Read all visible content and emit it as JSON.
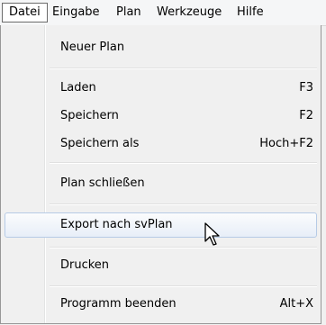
{
  "menubar": {
    "items": [
      {
        "label": "Datei"
      },
      {
        "label": "Eingabe"
      },
      {
        "label": "Plan"
      },
      {
        "label": "Werkzeuge"
      },
      {
        "label": "Hilfe"
      }
    ]
  },
  "file_menu": {
    "items": [
      {
        "label": "Neuer Plan",
        "shortcut": ""
      },
      {
        "label": "Laden",
        "shortcut": "F3"
      },
      {
        "label": "Speichern",
        "shortcut": "F2"
      },
      {
        "label": "Speichern als",
        "shortcut": "Hoch+F2"
      },
      {
        "label": "Plan schließen",
        "shortcut": ""
      },
      {
        "label": "Export nach svPlan",
        "shortcut": ""
      },
      {
        "label": "Drucken",
        "shortcut": ""
      },
      {
        "label": "Programm beenden",
        "shortcut": "Alt+X"
      }
    ],
    "highlighted": "Export nach svPlan"
  },
  "cursor_icon": "mouse-pointer-icon"
}
